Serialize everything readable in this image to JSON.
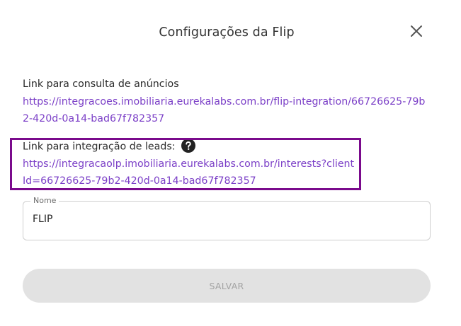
{
  "dialog": {
    "title": "Configurações da Flip",
    "close_icon": "close-icon"
  },
  "ads_link": {
    "label": "Link para consulta de anúncios",
    "url": "https://integracoes.imobiliaria.eurekalabs.com.br/flip-integration/66726625-79b2-420d-0a14-bad67f782357"
  },
  "leads_link": {
    "label": "Link para integração de leads:",
    "help_icon": "question-circle-icon",
    "url": "https://integracaolp.imobiliaria.eurekalabs.com.br/interests?clientId=66726625-79b2-420d-0a14-bad67f782357"
  },
  "name_field": {
    "legend": "Nome",
    "value": "FLIP"
  },
  "save_button": {
    "label": "SALVAR"
  },
  "colors": {
    "link": "#7b3fc7",
    "highlight": "#7a0a8c",
    "button_disabled_bg": "#e2e2e2",
    "button_disabled_text": "#a3a3a3"
  }
}
